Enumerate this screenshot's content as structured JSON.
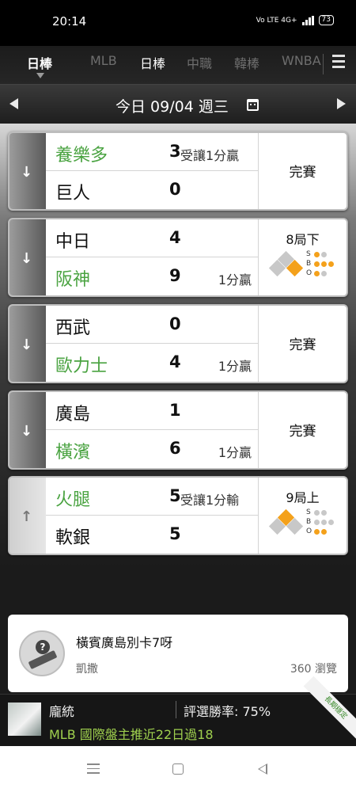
{
  "status_bar": {
    "time": "20:14",
    "network": "Vo LTE 4G+",
    "battery": "73"
  },
  "tabs": [
    {
      "label": "日棒",
      "active": true
    },
    {
      "label": "MLB",
      "active": false
    },
    {
      "label": "日棒",
      "active": false
    },
    {
      "label": "中職",
      "active": false
    },
    {
      "label": "韓棒",
      "active": false
    },
    {
      "label": "WNBA",
      "active": false
    }
  ],
  "date_bar": {
    "label": "今日 09/04 週三"
  },
  "games": [
    {
      "expand": "down",
      "top": {
        "team": "養樂多",
        "score": "3",
        "note": "受讓1分贏",
        "win": true
      },
      "bottom": {
        "team": "巨人",
        "score": "0",
        "note": "",
        "win": false
      },
      "status": "完賽"
    },
    {
      "expand": "down",
      "top": {
        "team": "中日",
        "score": "4",
        "note": "",
        "win": false
      },
      "bottom": {
        "team": "阪神",
        "score": "9",
        "note": "1分贏",
        "win": true
      },
      "inning": "8局下",
      "bases": [
        true,
        false,
        false
      ],
      "sbo": {
        "S": 1,
        "B": 3,
        "O": 1
      }
    },
    {
      "expand": "down",
      "top": {
        "team": "西武",
        "score": "0",
        "note": "",
        "win": false
      },
      "bottom": {
        "team": "歐力士",
        "score": "4",
        "note": "1分贏",
        "win": true
      },
      "status": "完賽"
    },
    {
      "expand": "down",
      "top": {
        "team": "廣島",
        "score": "1",
        "note": "",
        "win": false
      },
      "bottom": {
        "team": "橫濱",
        "score": "6",
        "note": "1分贏",
        "win": true
      },
      "status": "完賽"
    },
    {
      "expand": "up",
      "top": {
        "team": "火腿",
        "score": "5",
        "note": "受讓1分輸",
        "win": true
      },
      "bottom": {
        "team": "軟銀",
        "score": "5",
        "note": "",
        "win": false
      },
      "inning": "9局上",
      "bases": [
        false,
        false,
        true
      ],
      "sbo": {
        "S": 0,
        "B": 0,
        "O": 2
      }
    }
  ],
  "article": {
    "title": "橫賓廣島別卡7呀",
    "author": "凱撒",
    "views": "360 瀏覽"
  },
  "promo": {
    "name": "龐統",
    "rate": "評選勝率: 75%",
    "headline": "MLB 國際盤主推近22日過18",
    "ribbon": "長期穩定"
  },
  "colors": {
    "win_team": "#4aa341",
    "base_on": "#f4a11b",
    "promo_headline": "#9fd04e"
  },
  "icons": {
    "menu": "hamburger-icon",
    "prev": "left-arrow-icon",
    "next": "right-arrow-icon",
    "calendar": "calendar-icon"
  }
}
